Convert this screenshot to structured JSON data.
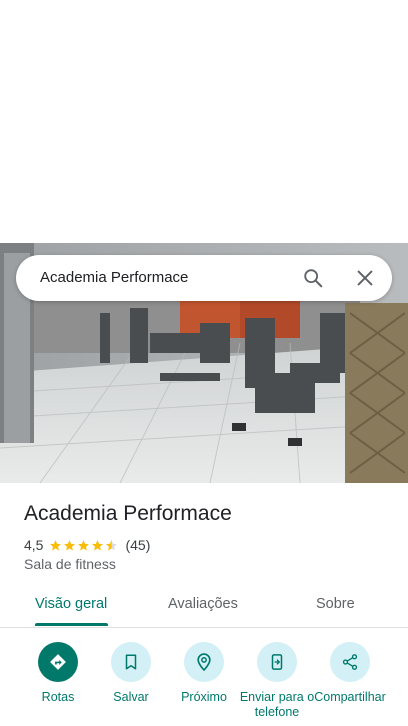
{
  "search": {
    "query": "Academia Performace"
  },
  "place": {
    "name": "Academia Performace",
    "rating": "4,5",
    "rating_value": 4.5,
    "review_count": "(45)",
    "category": "Sala de fitness"
  },
  "tabs": [
    {
      "label": "Visão geral",
      "active": true
    },
    {
      "label": "Avaliações",
      "active": false
    },
    {
      "label": "Sobre",
      "active": false
    }
  ],
  "actions": [
    {
      "label": "Rotas",
      "icon": "directions-icon"
    },
    {
      "label": "Salvar",
      "icon": "bookmark-icon"
    },
    {
      "label": "Próximo",
      "icon": "nearby-icon"
    },
    {
      "label": "Enviar para o telefone",
      "icon": "send-to-phone-icon"
    },
    {
      "label": "Compartilhar",
      "icon": "share-icon"
    }
  ],
  "colors": {
    "accent": "#00796b",
    "star": "#fbbc04",
    "action_circle": "#d2f0f5"
  }
}
